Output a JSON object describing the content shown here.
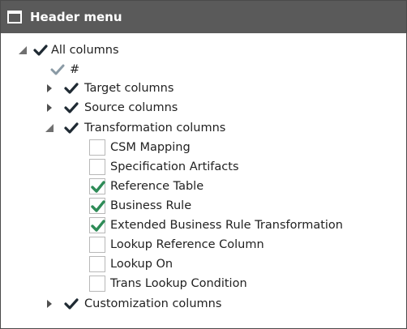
{
  "header": {
    "title": "Header menu"
  },
  "tree": {
    "root": {
      "label": "All columns",
      "checked": true,
      "expanded": true
    },
    "hash": {
      "label": "#",
      "checked": true,
      "disabled": true
    },
    "target": {
      "label": "Target columns",
      "checked": true,
      "expanded": false
    },
    "source": {
      "label": "Source columns",
      "checked": true,
      "expanded": false
    },
    "transformation": {
      "label": "Transformation columns",
      "checked": true,
      "expanded": true,
      "children": [
        {
          "label": "CSM Mapping",
          "checked": false
        },
        {
          "label": "Specification Artifacts",
          "checked": false
        },
        {
          "label": "Reference Table",
          "checked": true
        },
        {
          "label": "Business Rule",
          "checked": true
        },
        {
          "label": "Extended Business Rule Transformation",
          "checked": true
        },
        {
          "label": "Lookup Reference Column",
          "checked": false
        },
        {
          "label": "Lookup On",
          "checked": false
        },
        {
          "label": "Trans Lookup Condition",
          "checked": false
        }
      ]
    },
    "customization": {
      "label": "Customization columns",
      "checked": true,
      "expanded": false
    }
  },
  "colors": {
    "titlebar": "#5a5a5a",
    "check_dark": "#1f2a33",
    "check_green": "#2e8b57",
    "check_dim": "#8a9aa5"
  }
}
